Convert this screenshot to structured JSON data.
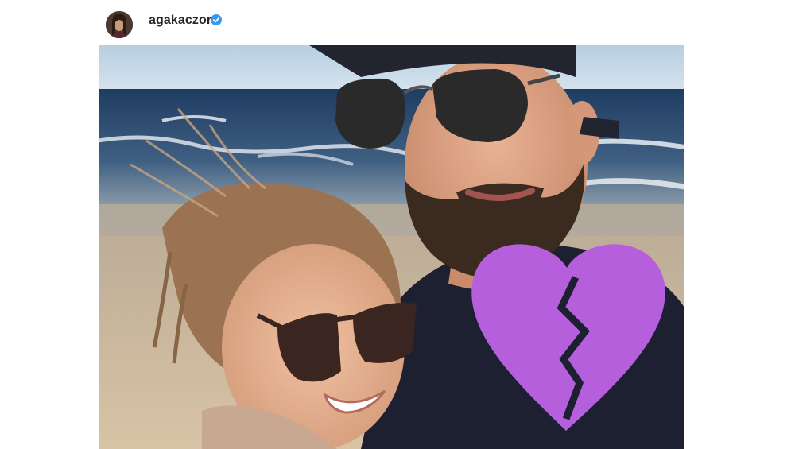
{
  "post": {
    "username": "agakaczor",
    "verified": true,
    "avatar_icon": "profile-avatar",
    "photo_description_icon": "beach-selfie-photo",
    "overlay_sticker_icon": "broken-heart-icon"
  },
  "colors": {
    "username": "#262626",
    "verified_badge": "#3897f0",
    "sticker": "#b65fdc"
  }
}
